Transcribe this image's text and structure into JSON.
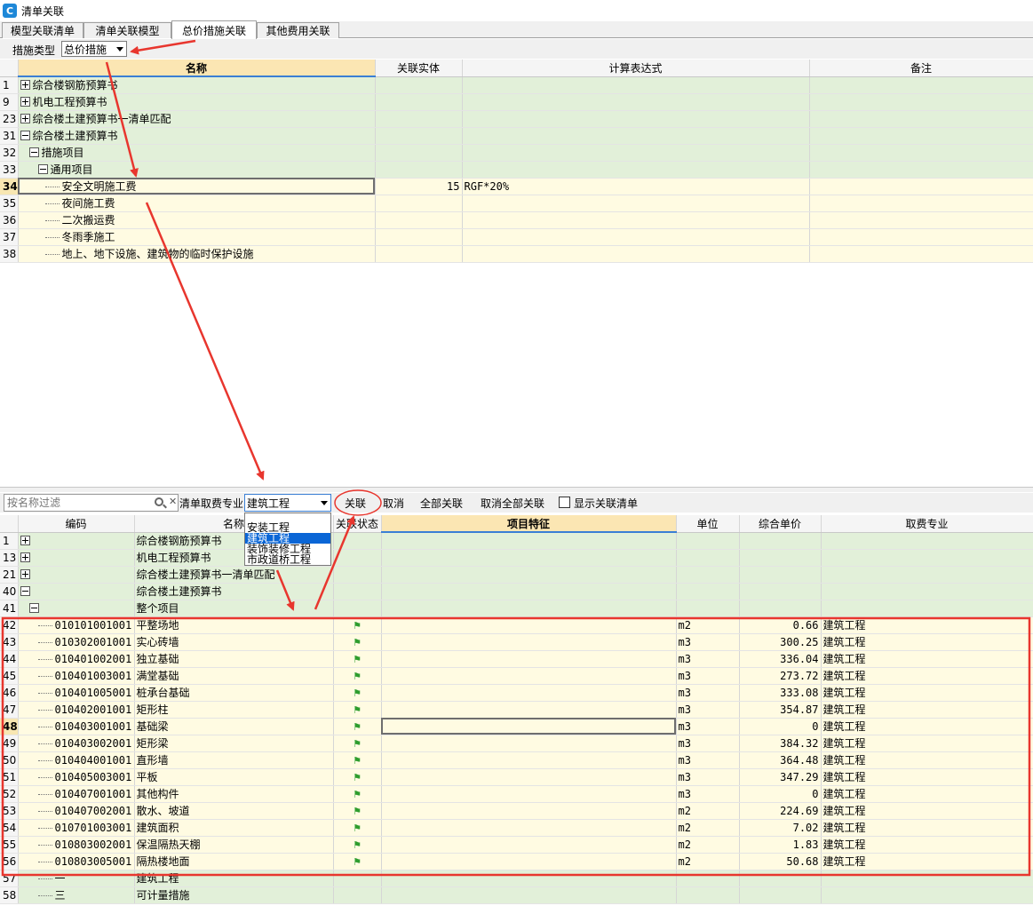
{
  "window": {
    "title": "清单关联"
  },
  "tabs": [
    "模型关联清单",
    "清单关联模型",
    "总价措施关联",
    "其他费用关联"
  ],
  "toolbar": {
    "type_label": "措施类型",
    "type_value": "总价措施"
  },
  "upper_grid": {
    "columns": [
      "名称",
      "关联实体",
      "计算表达式",
      "备注"
    ],
    "rows": [
      {
        "no": "1",
        "name": "综合楼钢筋预算书",
        "entity": "",
        "expr": "",
        "note": ""
      },
      {
        "no": "9",
        "name": "机电工程预算书",
        "entity": "",
        "expr": "",
        "note": ""
      },
      {
        "no": "23",
        "name": "综合楼土建预算书一清单匹配",
        "entity": "",
        "expr": "",
        "note": ""
      },
      {
        "no": "31",
        "name": "综合楼土建预算书",
        "entity": "",
        "expr": "",
        "note": ""
      },
      {
        "no": "32",
        "name": "措施项目",
        "entity": "",
        "expr": "",
        "note": ""
      },
      {
        "no": "33",
        "name": "通用项目",
        "entity": "",
        "expr": "",
        "note": ""
      },
      {
        "no": "34",
        "name": "安全文明施工费",
        "entity": "15",
        "expr": "RGF*20%",
        "note": ""
      },
      {
        "no": "35",
        "name": "夜间施工费",
        "entity": "",
        "expr": "",
        "note": ""
      },
      {
        "no": "36",
        "name": "二次搬运费",
        "entity": "",
        "expr": "",
        "note": ""
      },
      {
        "no": "37",
        "name": "冬雨季施工",
        "entity": "",
        "expr": "",
        "note": ""
      },
      {
        "no": "38",
        "name": "地上、地下设施、建筑物的临时保护设施",
        "entity": "",
        "expr": "",
        "note": ""
      }
    ]
  },
  "lower_toolbar": {
    "filter_placeholder": "按名称过滤",
    "specialty_label": "清单取费专业",
    "specialty_value": "建筑工程",
    "link_button": "关联",
    "cancel_button": "取消",
    "link_all_button": "全部关联",
    "cancel_all_button": "取消全部关联",
    "show_linked_label": "显示关联清单"
  },
  "dropdown_options": [
    "安装工程",
    "建筑工程",
    "装饰装修工程",
    "市政道桥工程"
  ],
  "lower_grid": {
    "columns": [
      "编码",
      "名称",
      "关联状态",
      "项目特征",
      "单位",
      "综合单价",
      "取费专业"
    ],
    "rows": [
      {
        "no": "1",
        "code": "",
        "name": "综合楼钢筋预算书",
        "unit": "",
        "price": "",
        "spec": ""
      },
      {
        "no": "13",
        "code": "",
        "name": "机电工程预算书",
        "unit": "",
        "price": "",
        "spec": ""
      },
      {
        "no": "21",
        "code": "",
        "name": "综合楼土建预算书一清单匹配",
        "unit": "",
        "price": "",
        "spec": ""
      },
      {
        "no": "40",
        "code": "",
        "name": "综合楼土建预算书",
        "unit": "",
        "price": "",
        "spec": ""
      },
      {
        "no": "41",
        "code": "",
        "name": "整个项目",
        "unit": "",
        "price": "",
        "spec": ""
      },
      {
        "no": "42",
        "code": "010101001001",
        "name": "平整场地",
        "unit": "m2",
        "price": "0.66",
        "spec": "建筑工程"
      },
      {
        "no": "43",
        "code": "010302001001",
        "name": "实心砖墙",
        "unit": "m3",
        "price": "300.25",
        "spec": "建筑工程"
      },
      {
        "no": "44",
        "code": "010401002001",
        "name": "独立基础",
        "unit": "m3",
        "price": "336.04",
        "spec": "建筑工程"
      },
      {
        "no": "45",
        "code": "010401003001",
        "name": "满堂基础",
        "unit": "m3",
        "price": "273.72",
        "spec": "建筑工程"
      },
      {
        "no": "46",
        "code": "010401005001",
        "name": "桩承台基础",
        "unit": "m3",
        "price": "333.08",
        "spec": "建筑工程"
      },
      {
        "no": "47",
        "code": "010402001001",
        "name": "矩形柱",
        "unit": "m3",
        "price": "354.87",
        "spec": "建筑工程"
      },
      {
        "no": "48",
        "code": "010403001001",
        "name": "基础梁",
        "unit": "m3",
        "price": "0",
        "spec": "建筑工程"
      },
      {
        "no": "49",
        "code": "010403002001",
        "name": "矩形梁",
        "unit": "m3",
        "price": "384.32",
        "spec": "建筑工程"
      },
      {
        "no": "50",
        "code": "010404001001",
        "name": "直形墙",
        "unit": "m3",
        "price": "364.48",
        "spec": "建筑工程"
      },
      {
        "no": "51",
        "code": "010405003001",
        "name": "平板",
        "unit": "m3",
        "price": "347.29",
        "spec": "建筑工程"
      },
      {
        "no": "52",
        "code": "010407001001",
        "name": "其他构件",
        "unit": "m3",
        "price": "0",
        "spec": "建筑工程"
      },
      {
        "no": "53",
        "code": "010407002001",
        "name": "散水、坡道",
        "unit": "m2",
        "price": "224.69",
        "spec": "建筑工程"
      },
      {
        "no": "54",
        "code": "010701003001",
        "name": "建筑面积",
        "unit": "m2",
        "price": "7.02",
        "spec": "建筑工程"
      },
      {
        "no": "55",
        "code": "010803002001",
        "name": "保温隔热天棚",
        "unit": "m2",
        "price": "1.83",
        "spec": "建筑工程"
      },
      {
        "no": "56",
        "code": "010803005001",
        "name": "隔热楼地面",
        "unit": "m2",
        "price": "50.68",
        "spec": "建筑工程"
      },
      {
        "no": "57",
        "code": "一",
        "name": "建筑工程",
        "unit": "",
        "price": "",
        "spec": ""
      },
      {
        "no": "58",
        "code": "三",
        "name": "可计量措施",
        "unit": "",
        "price": "",
        "spec": ""
      }
    ]
  },
  "colors": {
    "group_row": "#e2f0d9",
    "item_row": "#fffbe2",
    "header_highlight": "#fbe6b3",
    "annotation": "#e8362e",
    "selection": "#0a66d6"
  }
}
